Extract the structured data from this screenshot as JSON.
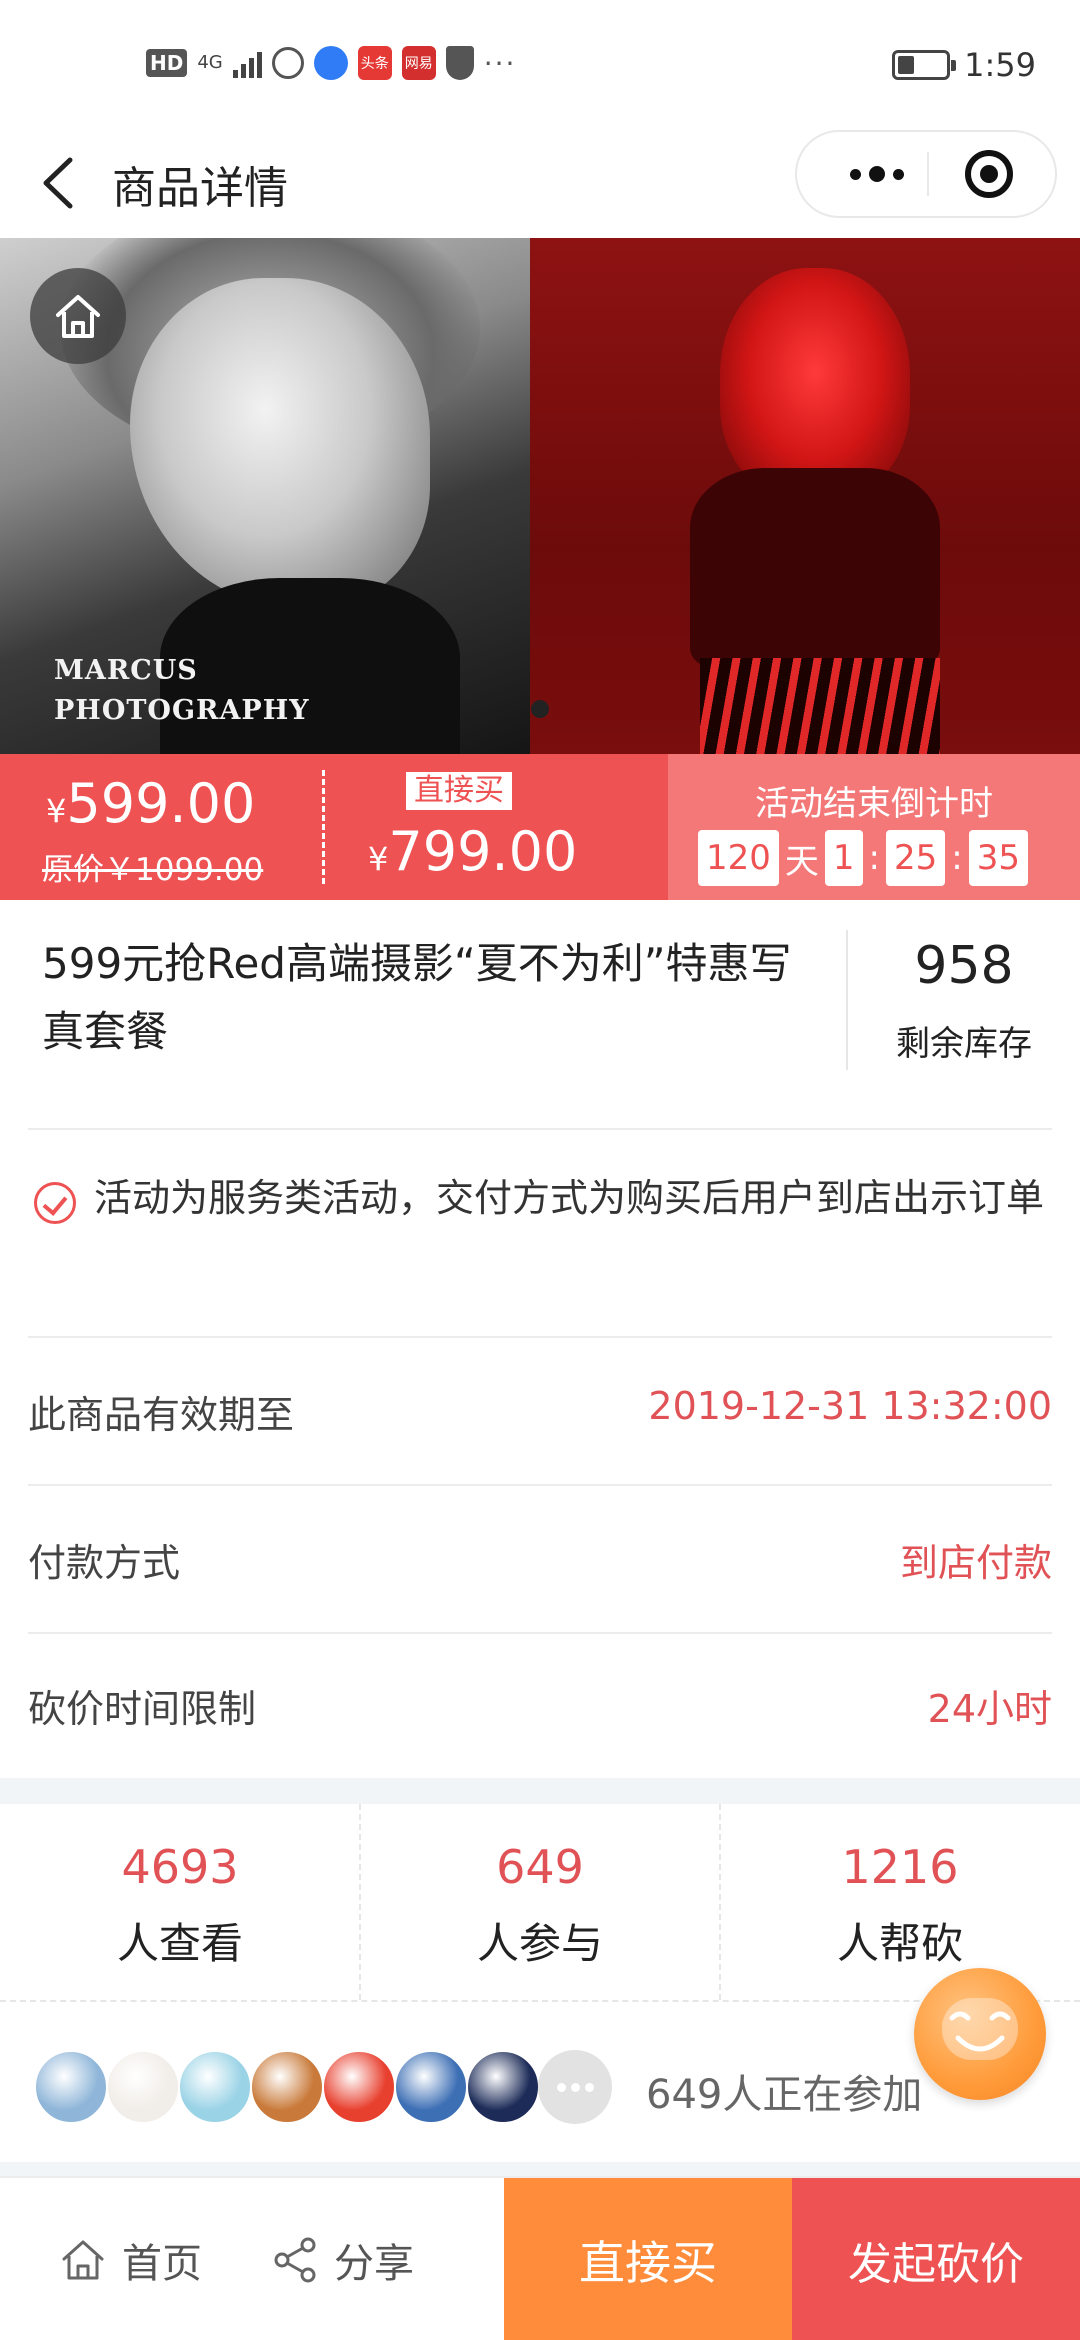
{
  "status_bar": {
    "network": "4G",
    "hd_label": "HD",
    "app_icons": [
      {
        "name": "globe-icon",
        "color": "#555555",
        "text": ""
      },
      {
        "name": "qq-browser-icon",
        "color": "#2f7cf6",
        "text": ""
      },
      {
        "name": "toutiao-icon",
        "color": "#e53935",
        "text": "头条"
      },
      {
        "name": "netease-icon",
        "color": "#d32f2f",
        "text": "网易"
      },
      {
        "name": "shield-check-icon",
        "color": "#555555",
        "text": ""
      }
    ],
    "overflow": "···",
    "battery_level": 0.35,
    "time": "1:59"
  },
  "nav": {
    "title": "商品详情"
  },
  "banner": {
    "watermark_line1": "MARCUS",
    "watermark_line2": "PHOTOGRAPHY",
    "slide_count": 1,
    "active_slide": 1
  },
  "price": {
    "currency": "¥",
    "bargain_price": "599.00",
    "original_label": "原价￥1099.00",
    "direct_buy_tag": "直接买",
    "direct_price": "799.00",
    "countdown_title": "活动结束倒计时",
    "countdown": {
      "days": "120",
      "day_unit": "天",
      "hours": "1",
      "minutes": "25",
      "seconds": "35",
      "colon": ":"
    }
  },
  "product": {
    "title": "599元抢Red高端摄影“夏不为利”特惠写真套餐",
    "stock": "958",
    "stock_label": "剩余库存"
  },
  "notice": "活动为服务类活动，交付方式为购买后用户到店出示订单",
  "info": [
    {
      "label": "此商品有效期至",
      "value": "2019-12-31 13:32:00"
    },
    {
      "label": "付款方式",
      "value": "到店付款"
    },
    {
      "label": "砍价时间限制",
      "value": "24小时"
    }
  ],
  "stats": [
    {
      "value": "4693",
      "label": "人查看"
    },
    {
      "value": "649",
      "label": "人参与"
    },
    {
      "value": "1216",
      "label": "人帮砍"
    }
  ],
  "participants": {
    "avatar_colors": [
      "#8fb6d9",
      "#f1ede8",
      "#9ad3e6",
      "#c97a3a",
      "#e8402f",
      "#3d6fb5",
      "#1c2b58"
    ],
    "text": "649人正在参加"
  },
  "bottom_bar": {
    "home_label": "首页",
    "share_label": "分享",
    "buy_label": "直接买",
    "bargain_label": "发起砍价"
  },
  "colors": {
    "accent_red": "#ee5253",
    "accent_orange": "#ff8c3a",
    "countdown_bg": "#f47878"
  }
}
